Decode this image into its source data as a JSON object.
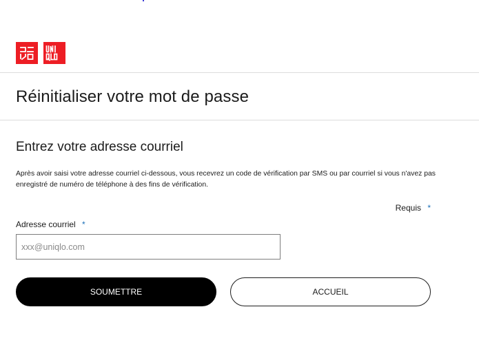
{
  "brand": {
    "logo_katakana": "ユニクロ",
    "logo_latin": "UNIQLO",
    "color": "#ed1d24"
  },
  "header": {
    "title": "Réinitialiser votre mot de passe"
  },
  "form": {
    "section_title": "Entrez votre adresse courriel",
    "description": "Après avoir saisi votre adresse courriel ci-dessous, vous recevrez un code de vérification par SMS ou par courriel si vous n'avez pas enregistré de numéro de téléphone à des fins de vérification.",
    "required_label": "Requis",
    "required_marker": "*",
    "email_label": "Adresse courriel",
    "email_value": "",
    "email_placeholder": "xxx@uniqlo.com",
    "submit_label": "SOUMETTRE",
    "home_label": "ACCUEIL",
    "accent_color": "#1b6fb8"
  }
}
